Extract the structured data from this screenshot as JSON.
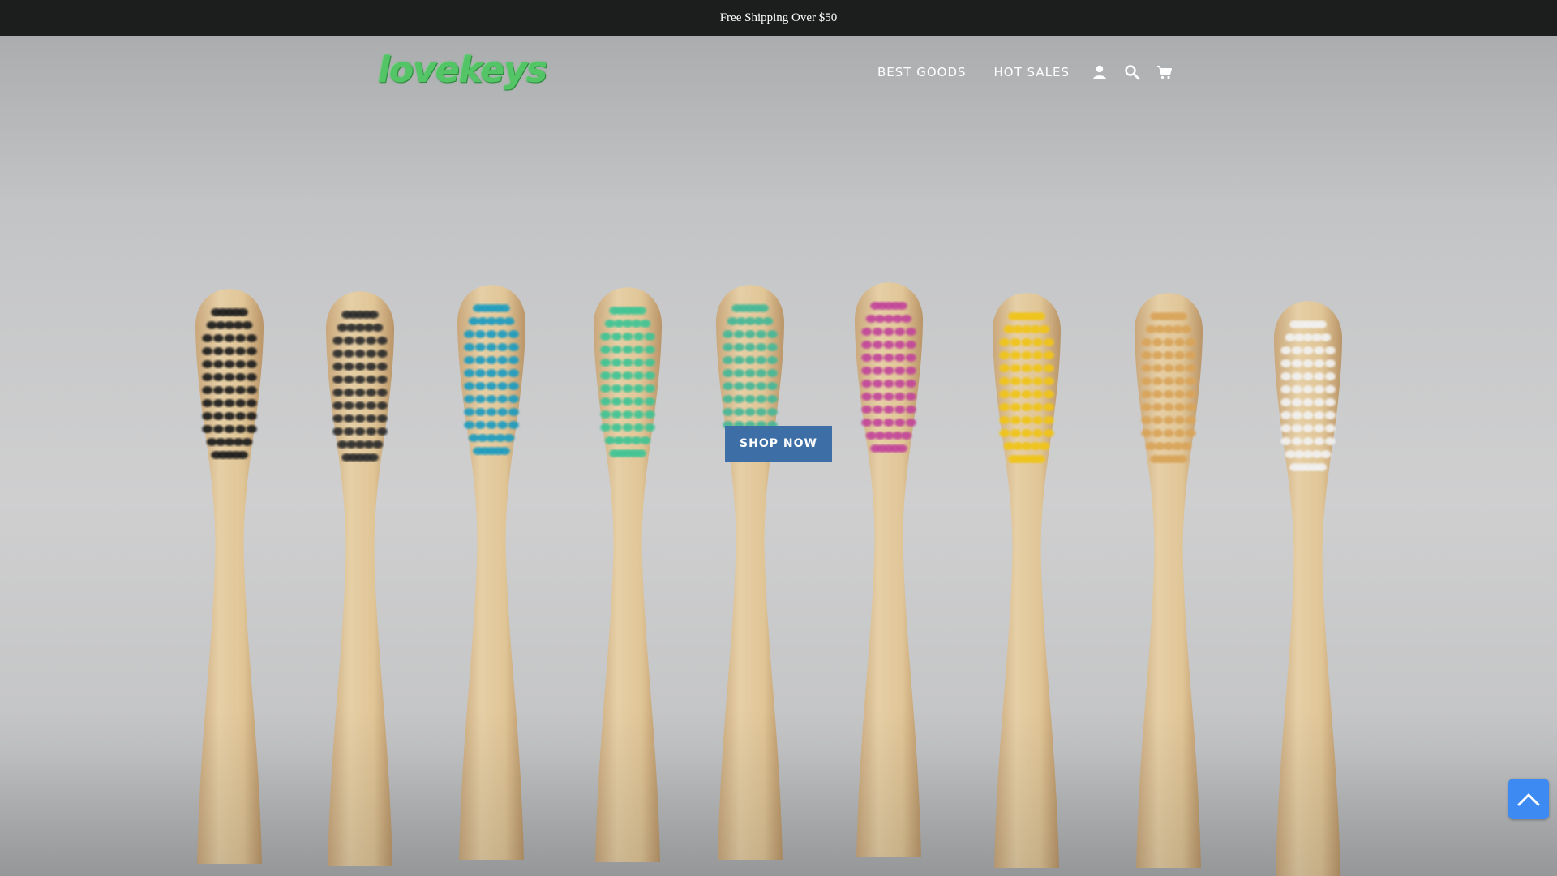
{
  "announcement": {
    "text": "Free Shipping Over $50"
  },
  "header": {
    "logo_text": "lovekeys",
    "nav": [
      {
        "label": "BEST GOODS"
      },
      {
        "label": "HOT SALES"
      }
    ],
    "icons": [
      "account-icon",
      "search-icon",
      "cart-icon"
    ]
  },
  "hero": {
    "cta_label": "SHOP NOW",
    "bristle_colors": [
      "#1f1f1f",
      "#2c2c2c",
      "#1f9cc0",
      "#3cc494",
      "#45b897",
      "#c2459a",
      "#f0c419",
      "#d9a45a",
      "#f2f2f2"
    ]
  },
  "back_to_top": {
    "icon": "chevron-up-icon"
  },
  "colors": {
    "announcement_bg": "#1c1d1d",
    "button_bg": "#3d6ea6",
    "logo_green": "#53c566",
    "back_to_top_bg": "#3d8bf2"
  }
}
